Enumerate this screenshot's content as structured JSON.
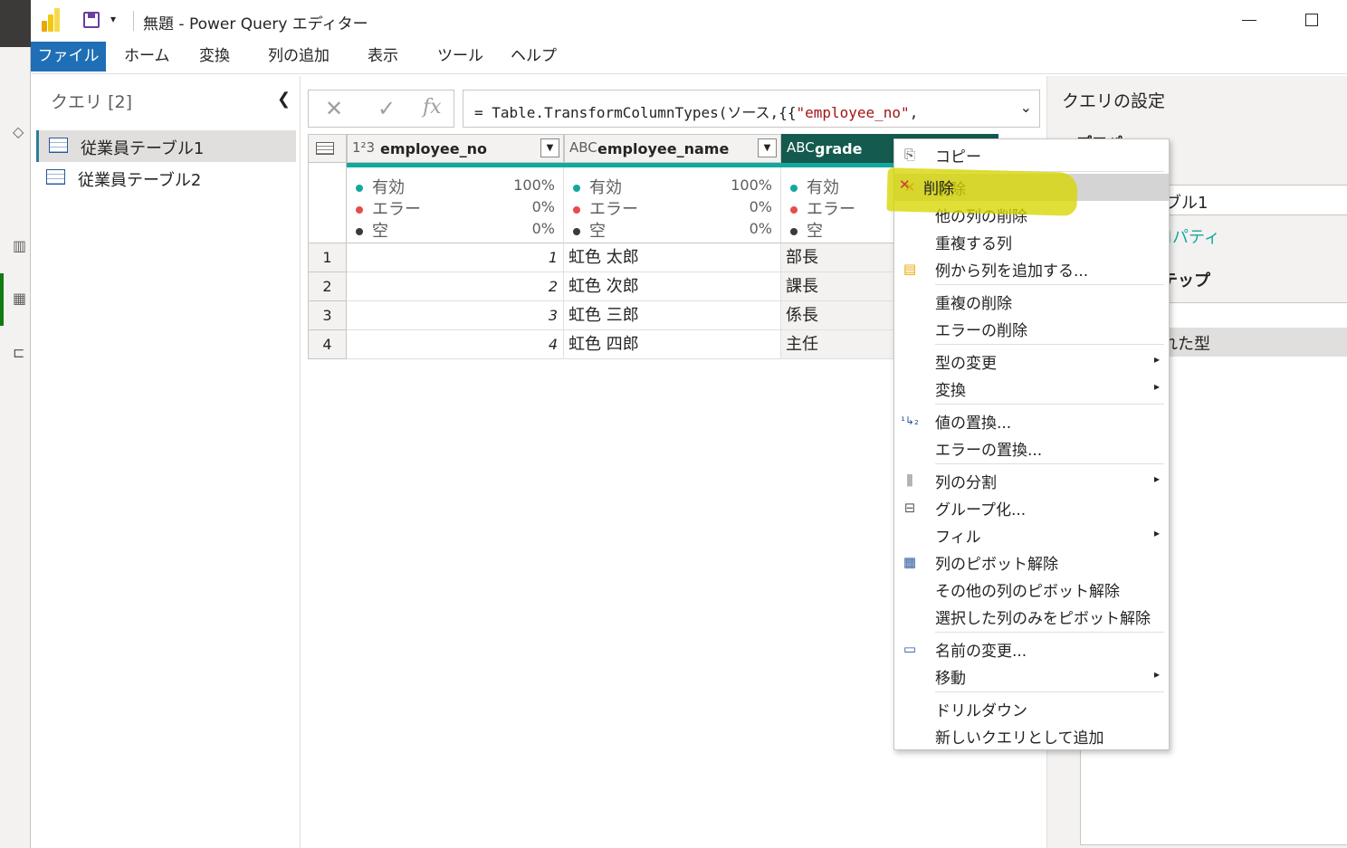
{
  "window": {
    "title": "無題 - Power Query エディター"
  },
  "ribbon": {
    "tabs": [
      "ファイル",
      "ホーム",
      "変換",
      "列の追加",
      "表示",
      "ツール",
      "ヘルプ"
    ]
  },
  "queries": {
    "header": "クエリ",
    "count": "[2]",
    "items": [
      "従業員テーブル1",
      "従業員テーブル2"
    ],
    "selected_index": 0
  },
  "formula": {
    "prefix": "= Table.TransformColumnTypes(ソース,{{",
    "string": "\"employee_no\"",
    "suffix": ","
  },
  "grid": {
    "columns": [
      {
        "type": "1²3",
        "name": "employee_no",
        "valid": "100%",
        "error": "0%",
        "empty": "0%"
      },
      {
        "type": "ABC",
        "name": "employee_name",
        "valid": "100%",
        "error": "0%",
        "empty": "0%"
      },
      {
        "type": "ABC",
        "name": "grade"
      }
    ],
    "stat_labels": {
      "valid": "有効",
      "error": "エラー",
      "empty": "空"
    },
    "rows": [
      {
        "num": "1",
        "employee_no": "1",
        "employee_name": "虹色  太郎",
        "grade": "部長"
      },
      {
        "num": "2",
        "employee_no": "2",
        "employee_name": "虹色  次郎",
        "grade": "課長"
      },
      {
        "num": "3",
        "employee_no": "3",
        "employee_name": "虹色  三郎",
        "grade": "係長"
      },
      {
        "num": "4",
        "employee_no": "4",
        "employee_name": "虹色  四郎",
        "grade": "主任"
      }
    ]
  },
  "settings": {
    "title": "クエリの設定",
    "properties_label": "プロパ",
    "name_fragment": "ブル1",
    "all_properties_fragment": "ロパティ",
    "steps_fragment": "テップ",
    "selected_step_fragment": "れた型"
  },
  "context_menu": {
    "items": [
      {
        "label": "コピー",
        "icon": "copy-icon"
      },
      {
        "label": "削除",
        "icon": "delete-column-icon",
        "hover": true
      },
      {
        "label": "他の列の削除"
      },
      {
        "label": "重複する列"
      },
      {
        "label": "例から列を追加する...",
        "icon": "column-from-examples-icon"
      },
      {
        "label": "重複の削除"
      },
      {
        "label": "エラーの削除"
      },
      {
        "label": "型の変更",
        "submenu": true
      },
      {
        "label": "変換",
        "submenu": true
      },
      {
        "label": "値の置換...",
        "icon": "replace-values-icon"
      },
      {
        "label": "エラーの置換..."
      },
      {
        "label": "列の分割",
        "icon": "split-column-icon",
        "submenu": true
      },
      {
        "label": "グループ化...",
        "icon": "group-by-icon"
      },
      {
        "label": "フィル",
        "submenu": true
      },
      {
        "label": "列のピボット解除",
        "icon": "unpivot-icon"
      },
      {
        "label": "その他の列のピボット解除"
      },
      {
        "label": "選択した列のみをピボット解除"
      },
      {
        "label": "名前の変更...",
        "icon": "rename-icon"
      },
      {
        "label": "移動",
        "submenu": true
      },
      {
        "label": "ドリルダウン"
      },
      {
        "label": "新しいクエリとして追加"
      }
    ]
  },
  "colors": {
    "file_tab": "#1f6fb6",
    "selected_header": "#145a4e",
    "quality_bar": "#13a89e",
    "valid_dot": "#13a89e",
    "error_dot": "#e74c4c",
    "empty_dot": "#3b3a39",
    "highlighter": "#d6d600"
  }
}
